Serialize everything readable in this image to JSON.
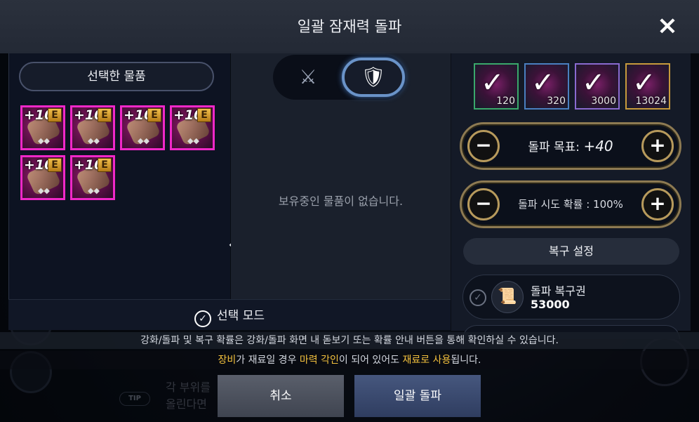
{
  "dialog": {
    "title": "일괄 잠재력 돌파",
    "close_icon": "×"
  },
  "background": {
    "tip_label": "TIP",
    "text_line1": "각 부위를",
    "text_line2": "올린다면"
  },
  "left_panel": {
    "selected_header": "선택한 물품",
    "items": [
      {
        "level": "+10",
        "grade": "E"
      },
      {
        "level": "+10",
        "grade": "E"
      },
      {
        "level": "+10",
        "grade": "E"
      },
      {
        "level": "+10",
        "grade": "E"
      },
      {
        "level": "+10",
        "grade": "E"
      },
      {
        "level": "+10",
        "grade": "E"
      }
    ]
  },
  "middle_panel": {
    "weapon_tab_icon": "⚔",
    "armor_tab_icon": "🛡",
    "empty_message": "보유중인 물품이 없습니다."
  },
  "right_panel": {
    "materials": [
      {
        "count": "120",
        "color": "#3aa86b"
      },
      {
        "count": "320",
        "color": "#4a7fc0"
      },
      {
        "count": "3000",
        "color": "#8a6ad0"
      },
      {
        "count": "13024",
        "color": "#c79a3c"
      }
    ],
    "target": {
      "label": "돌파 목표:",
      "value": "+40"
    },
    "chance": {
      "label": "돌파 시도 확률 : 100%"
    },
    "recovery_header": "복구 설정",
    "voucher": {
      "name": "돌파 복구권",
      "count": "53000"
    }
  },
  "selection_mode": {
    "label": "선택 모드"
  },
  "notices": {
    "line1": "강화/돌파 및 복구 확률은 강화/돌파 화면 내 돋보기 또는 확률 안내 버튼을 통해 확인하실 수 있습니다.",
    "line2_a": "장비",
    "line2_b": "가 재료일 경우 ",
    "line2_c": "마력 각인",
    "line2_d": "이 되어 있어도 ",
    "line2_e": "재료로 사용",
    "line2_f": "됩니다."
  },
  "buttons": {
    "cancel": "취소",
    "confirm": "일괄 돌파"
  },
  "colors": {
    "highlight": "#f3c13d",
    "item_border": "#f028c8",
    "toggle_active": "#6a93c8",
    "stepper_border": "#8d7a52"
  }
}
